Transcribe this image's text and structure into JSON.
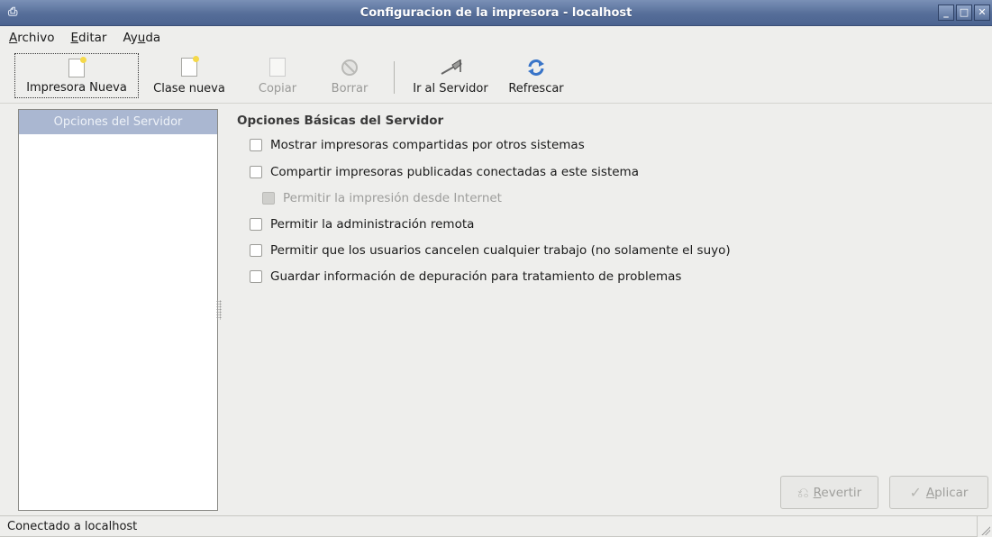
{
  "window": {
    "title": "Configuracion de la impresora - localhost",
    "controls": [
      "minimize",
      "maximize",
      "close"
    ]
  },
  "menu": {
    "items": [
      {
        "label": "Archivo",
        "mnemonic_index": 0
      },
      {
        "label": "Editar",
        "mnemonic_index": 0
      },
      {
        "label": "Ayuda",
        "mnemonic_index": 2
      }
    ]
  },
  "toolbar": {
    "new_printer": "Impresora Nueva",
    "new_class": "Clase nueva",
    "copy": "Copiar",
    "delete": "Borrar",
    "go_server": "Ir al Servidor",
    "refresh": "Refrescar"
  },
  "sidebar": {
    "header": "Opciones del Servidor"
  },
  "main": {
    "section_title": "Opciones Básicas del Servidor",
    "options": [
      {
        "label": "Mostrar impresoras compartidas por otros sistemas",
        "checked": false,
        "enabled": true
      },
      {
        "label": "Compartir impresoras publicadas conectadas a este sistema",
        "checked": false,
        "enabled": true
      },
      {
        "label": "Permitir la impresión desde Internet",
        "checked": false,
        "enabled": false
      },
      {
        "label": "Permitir la administración remota",
        "checked": false,
        "enabled": true
      },
      {
        "label": "Permitir que los usuarios cancelen cualquier trabajo (no solamente el suyo)",
        "checked": false,
        "enabled": true
      },
      {
        "label": "Guardar información de depuración para tratamiento de problemas",
        "checked": false,
        "enabled": true
      }
    ]
  },
  "buttons": {
    "revert": "Revertir",
    "apply": "Aplicar"
  },
  "status": {
    "text": "Conectado a localhost"
  },
  "colors": {
    "titlebar": "#566e99",
    "sidebar_header": "#aab7d1"
  }
}
